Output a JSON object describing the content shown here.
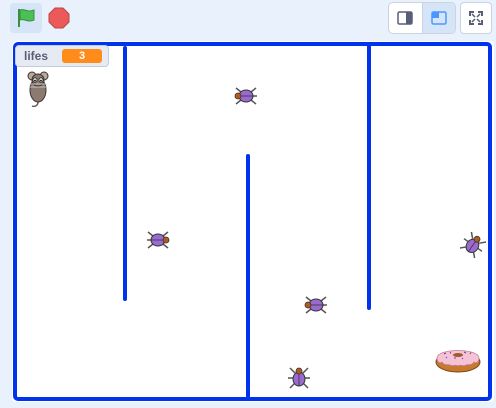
{
  "toolbar": {
    "green_flag_icon": "green-flag-icon",
    "stop_icon": "stop-sign-icon",
    "small_stage_icon": "small-stage-icon",
    "large_stage_icon": "large-stage-icon",
    "fullscreen_icon": "fullscreen-icon"
  },
  "monitor": {
    "label": "lifes",
    "value": "3"
  },
  "colors": {
    "wall": "#0033ee",
    "monitor_value_bg": "#ff8c1a",
    "flag": "#4cbf56",
    "stop": "#ec5959"
  },
  "sprites": {
    "player": "mouse",
    "enemies": [
      "beetle",
      "beetle",
      "beetle",
      "beetle",
      "beetle"
    ],
    "goal": "donut"
  }
}
